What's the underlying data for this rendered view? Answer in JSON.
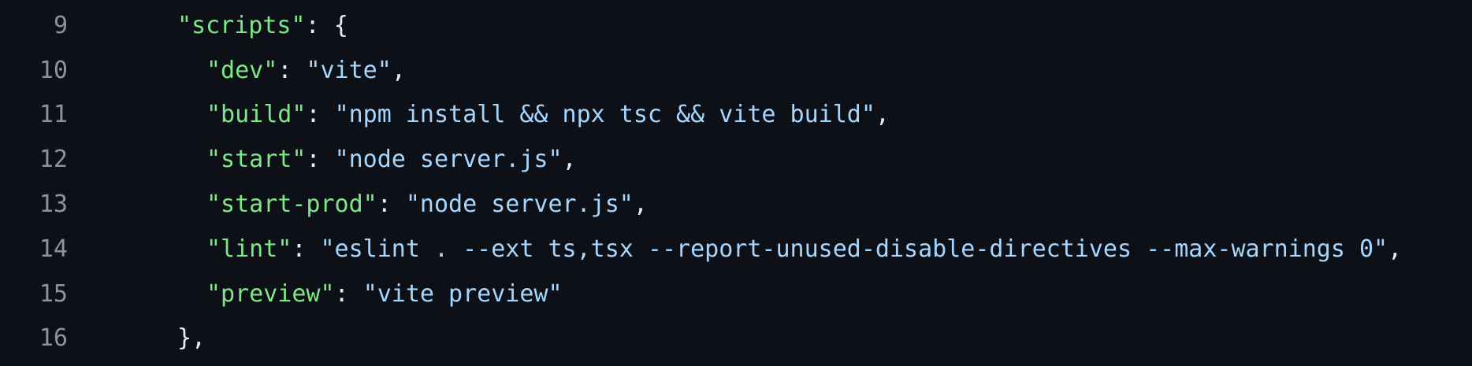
{
  "colors": {
    "background": "#0d1117",
    "line_number": "#8b949e",
    "key": "#7ee787",
    "string": "#a5d6ff",
    "punctuation": "#e6edf3"
  },
  "lines": [
    {
      "number": "9",
      "key": "\"scripts\"",
      "sep": ": ",
      "value": "",
      "tail": "{"
    },
    {
      "number": "10",
      "key": "\"dev\"",
      "sep": ": ",
      "value": "\"vite\"",
      "tail": ","
    },
    {
      "number": "11",
      "key": "\"build\"",
      "sep": ": ",
      "value": "\"npm install && npx tsc && vite build\"",
      "tail": ","
    },
    {
      "number": "12",
      "key": "\"start\"",
      "sep": ": ",
      "value": "\"node server.js\"",
      "tail": ","
    },
    {
      "number": "13",
      "key": "\"start-prod\"",
      "sep": ": ",
      "value": "\"node server.js\"",
      "tail": ","
    },
    {
      "number": "14",
      "key": "\"lint\"",
      "sep": ": ",
      "value": "\"eslint . --ext ts,tsx --report-unused-disable-directives --max-warnings 0\"",
      "tail": ","
    },
    {
      "number": "15",
      "key": "\"preview\"",
      "sep": ": ",
      "value": "\"vite preview\"",
      "tail": ""
    },
    {
      "number": "16",
      "key": "",
      "sep": "",
      "value": "",
      "tail": "},"
    }
  ]
}
